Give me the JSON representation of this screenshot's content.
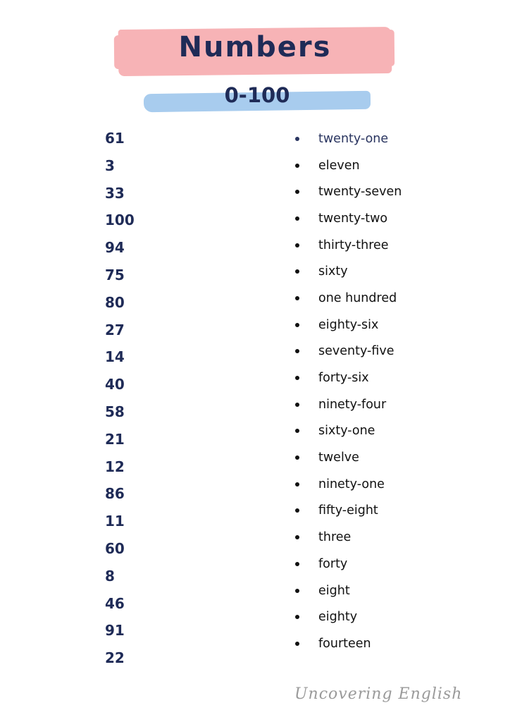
{
  "header": {
    "title": "Numbers",
    "subtitle": "0-100"
  },
  "colors": {
    "title_brush": "#f7b3b6",
    "subtitle_brush": "#a8ccee",
    "navy_text": "#1f2b57"
  },
  "numbers": [
    "61",
    "3",
    "33",
    "100",
    "94",
    "75",
    "80",
    "27",
    "14",
    "40",
    "58",
    "21",
    "12",
    "86",
    "11",
    "60",
    "8",
    "46",
    "91",
    "22"
  ],
  "words": [
    "twenty-one",
    "eleven",
    "twenty-seven",
    "twenty-two",
    "thirty-three",
    "sixty",
    "one hundred",
    "eighty-six",
    "seventy-five",
    "forty-six",
    "ninety-four",
    "sixty-one",
    "twelve",
    "ninety-one",
    "fifty-eight",
    "three",
    "forty",
    "eight",
    "eighty",
    "fourteen"
  ],
  "footer": {
    "signature": "Uncovering English"
  }
}
